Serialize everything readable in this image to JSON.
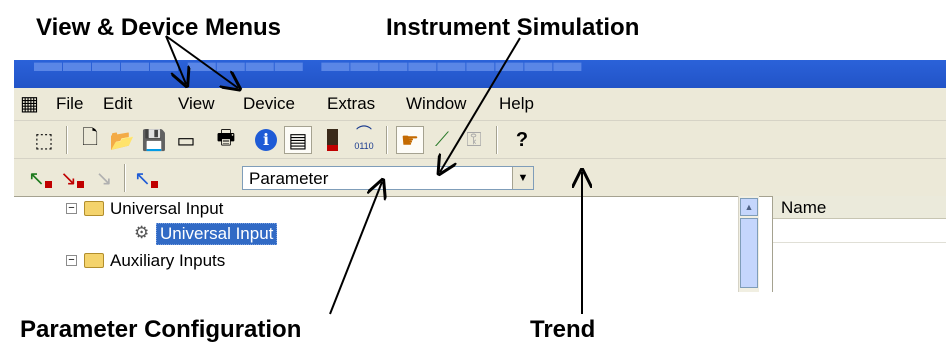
{
  "callouts": {
    "view_device": "View & Device Menus",
    "instrument_sim": "Instrument Simulation",
    "param_config": "Parameter Configuration",
    "trend": "Trend"
  },
  "window": {
    "menu": [
      {
        "key": "file",
        "label": "File"
      },
      {
        "key": "edit",
        "label": "Edit"
      },
      {
        "key": "view",
        "label": "View"
      },
      {
        "key": "device",
        "label": "Device"
      },
      {
        "key": "extras",
        "label": "Extras"
      },
      {
        "key": "window",
        "label": "Window"
      },
      {
        "key": "help",
        "label": "Help"
      }
    ],
    "toolbar1_icons": [
      "select-tool-icon",
      "new-document-icon",
      "open-folder-icon",
      "save-disk-icon",
      "card-icon",
      "print-icon",
      "info-icon",
      "parameter-configuration-icon",
      "instrument-simulation-icon",
      "curve-0110-icon",
      "hand-icon",
      "trend-icon",
      "key-icon",
      "help-icon"
    ],
    "curve_icon_text": "0110",
    "toolbar2_icons": [
      "upload-arrow-icon",
      "download-arrow-icon",
      "transfer-disabled-icon",
      "info-transfer-icon"
    ],
    "combo": {
      "value": "Parameter"
    },
    "tree": {
      "items": [
        {
          "label": "Universal Input"
        },
        {
          "label": "Universal Input"
        },
        {
          "label": "Auxiliary Inputs"
        }
      ]
    },
    "grid": {
      "column_header": "Name"
    }
  },
  "colors": {
    "selection": "#316ac5",
    "window_bg": "#ece9d8",
    "titlebar": "#2b62d9"
  }
}
